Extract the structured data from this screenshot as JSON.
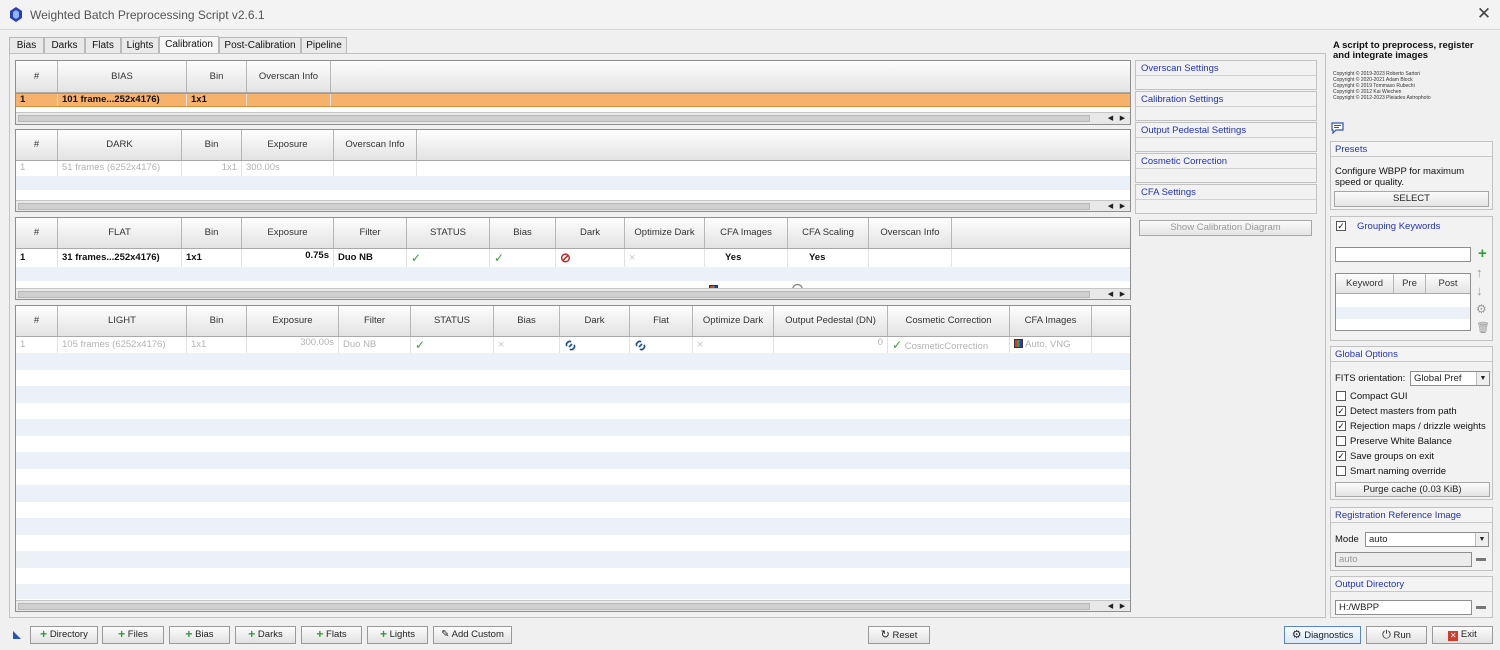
{
  "window": {
    "title": "Weighted Batch Preprocessing Script v2.6.1"
  },
  "tabs": [
    {
      "label": "Bias",
      "active": false
    },
    {
      "label": "Darks",
      "active": false
    },
    {
      "label": "Flats",
      "active": false
    },
    {
      "label": "Lights",
      "active": false
    },
    {
      "label": "Calibration",
      "active": true
    },
    {
      "label": "Post-Calibration",
      "active": false
    },
    {
      "label": "Pipeline",
      "active": false
    }
  ],
  "bias_table": {
    "headers": [
      "#",
      "BIAS",
      "Bin",
      "Overscan Info"
    ],
    "rows": [
      [
        "1",
        "101 frame...252x4176)",
        "1x1",
        ""
      ]
    ]
  },
  "dark_table": {
    "headers": [
      "#",
      "DARK",
      "Bin",
      "Exposure",
      "Overscan Info"
    ],
    "rows": [
      [
        "1",
        "51 frames (6252x4176)",
        "1x1",
        "300.00s",
        ""
      ]
    ]
  },
  "flat_table": {
    "headers": [
      "#",
      "FLAT",
      "Bin",
      "Exposure",
      "Filter",
      "STATUS",
      "Bias",
      "Dark",
      "Optimize Dark",
      "CFA Images",
      "CFA Scaling",
      "Overscan Info"
    ],
    "rows": [
      [
        "1",
        "31 frames...252x4176)",
        "1x1",
        "0.75s",
        "Duo NB",
        "✓",
        "✓",
        "⊘",
        "×",
        "Yes",
        "Yes",
        ""
      ]
    ]
  },
  "light_table": {
    "headers": [
      "#",
      "LIGHT",
      "Bin",
      "Exposure",
      "Filter",
      "STATUS",
      "Bias",
      "Dark",
      "Flat",
      "Optimize Dark",
      "Output Pedestal (DN)",
      "Cosmetic Correction",
      "CFA Images"
    ],
    "rows": [
      [
        "1",
        "105 frames (6252x4176)",
        "1x1",
        "300.00s",
        "Duo NB",
        "✓",
        "×",
        "link",
        "link",
        "×",
        "0",
        "CosmeticCorrection",
        "Auto, VNG"
      ]
    ]
  },
  "calibration_sections": [
    "Overscan Settings",
    "Calibration Settings",
    "Output Pedestal Settings",
    "Cosmetic Correction",
    "CFA Settings"
  ],
  "show_diagram_label": "Show Calibration Diagram",
  "about": {
    "heading": "A script to preprocess, register and integrate images",
    "copyrights": [
      "Copyright © 2019-2023 Roberto Sartori",
      "Copyright © 2020-2021 Adam Block",
      "Copyright © 2019 Tommaso Rubechi",
      "Copyright © 2012 Kai Wiechen",
      "Copyright © 2012-2023 Pleiades Astrophoto"
    ]
  },
  "presets": {
    "title": "Presets",
    "description": "Configure WBPP for maximum speed or quality.",
    "button": "SELECT"
  },
  "grouping": {
    "title": "Grouping Keywords",
    "checked": true,
    "input_value": "",
    "columns": [
      "Keyword",
      "Pre",
      "Post"
    ]
  },
  "global_options": {
    "title": "Global Options",
    "fits_label": "FITS orientation:",
    "fits_value": "Global Pref",
    "checkboxes": [
      {
        "label": "Compact GUI",
        "checked": false
      },
      {
        "label": "Detect masters from path",
        "checked": true
      },
      {
        "label": "Rejection maps / drizzle weights",
        "checked": true
      },
      {
        "label": "Preserve White Balance",
        "checked": false
      },
      {
        "label": "Save groups on exit",
        "checked": true
      },
      {
        "label": "Smart naming override",
        "checked": false
      }
    ],
    "purge_button": "Purge cache (0.03 KiB)"
  },
  "registration": {
    "title": "Registration Reference Image",
    "mode_label": "Mode",
    "mode_value": "auto",
    "path_value": "auto"
  },
  "output_directory": {
    "title": "Output Directory",
    "value": "H:/WBPP"
  },
  "bottom_buttons": {
    "directory": "Directory",
    "files": "Files",
    "bias": "Bias",
    "darks": "Darks",
    "flats": "Flats",
    "lights": "Lights",
    "add_custom": "Add Custom",
    "reset": "Reset",
    "diagnostics": "Diagnostics",
    "run": "Run",
    "exit": "Exit"
  },
  "colors": {
    "selected_row": "#f6b26b",
    "accent_green": "#2e9e3b",
    "section_blue": "#2233bb"
  }
}
